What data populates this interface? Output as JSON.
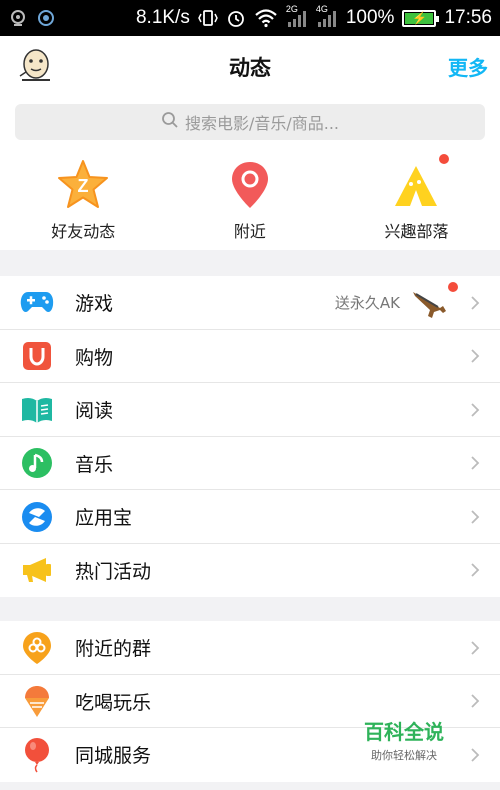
{
  "status_bar": {
    "speed": "8.1K/s",
    "net1": "2G",
    "net2": "4G",
    "battery": "100%",
    "time": "17:56"
  },
  "header": {
    "title": "动态",
    "more_label": "更多"
  },
  "search": {
    "placeholder": "搜索电影/音乐/商品..."
  },
  "quick_actions": [
    {
      "label": "好友动态",
      "icon": "qzone-star-icon"
    },
    {
      "label": "附近",
      "icon": "location-pin-icon"
    },
    {
      "label": "兴趣部落",
      "icon": "tent-icon",
      "badge": true
    }
  ],
  "group1": [
    {
      "label": "游戏",
      "icon": "gamepad-icon",
      "extra": "送永久AK",
      "badge": true
    },
    {
      "label": "购物",
      "icon": "shopping-magnet-icon"
    },
    {
      "label": "阅读",
      "icon": "book-icon"
    },
    {
      "label": "音乐",
      "icon": "music-note-icon"
    },
    {
      "label": "应用宝",
      "icon": "app-store-icon"
    },
    {
      "label": "热门活动",
      "icon": "megaphone-icon"
    }
  ],
  "group2": [
    {
      "label": "附近的群",
      "icon": "group-pin-icon"
    },
    {
      "label": "吃喝玩乐",
      "icon": "ice-cream-icon"
    },
    {
      "label": "同城服务",
      "icon": "balloon-icon"
    }
  ],
  "watermark": {
    "title": "百科全说",
    "subtitle": "助你轻松解决"
  },
  "colors": {
    "accent": "#12b7f5",
    "badge": "#f44c3b",
    "page_bg": "#f2f2f4"
  }
}
